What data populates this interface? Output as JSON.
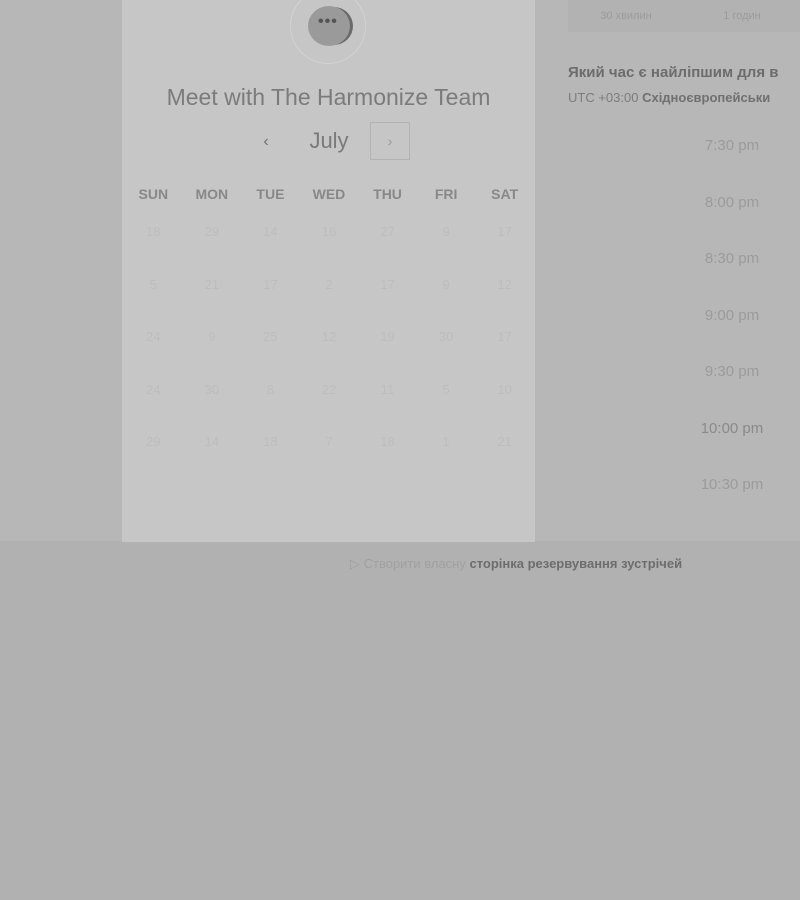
{
  "card": {
    "title": "Meet with The Harmonize Team",
    "month": "July",
    "prev_icon": "‹",
    "next_icon": "›",
    "avatar_dots": "•••",
    "weekdays": [
      "SUN",
      "MON",
      "TUE",
      "WED",
      "THU",
      "FRI",
      "SAT"
    ],
    "days": [
      "18",
      "29",
      "14",
      "16",
      "27",
      "9",
      "17",
      "5",
      "21",
      "17",
      "2",
      "17",
      "9",
      "12",
      "24",
      "9",
      "25",
      "12",
      "19",
      "30",
      "17",
      "24",
      "30",
      "8",
      "22",
      "11",
      "5",
      "10",
      "29",
      "14",
      "18",
      "7",
      "18",
      "1",
      "21"
    ]
  },
  "duration": {
    "tabs": [
      "30 хвилин",
      "1 годин"
    ]
  },
  "scheduler": {
    "question": "Який час є найліпшим для в",
    "tz_offset": "UTC +03:00",
    "tz_name": "Східноєвропейськи",
    "slots": [
      "7:30 pm",
      "8:00 pm",
      "8:30 pm",
      "9:00 pm",
      "9:30 pm",
      "10:00 pm",
      "10:30 pm"
    ]
  },
  "footer": {
    "prefix": "▷ Створити власну",
    "link": "сторінка резервування зустрічей"
  }
}
